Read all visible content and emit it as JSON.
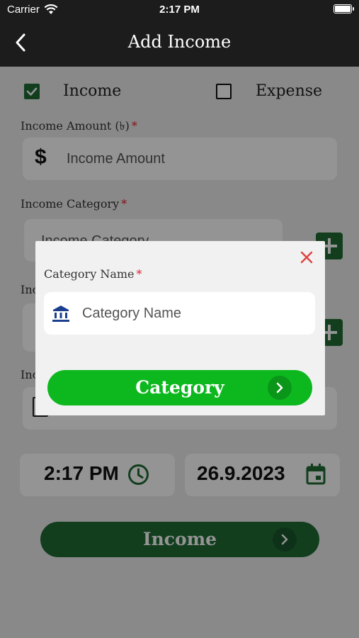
{
  "status_bar": {
    "carrier": "Carrier",
    "time": "2:17 PM"
  },
  "nav": {
    "title": "Add Income"
  },
  "type_toggle": {
    "income_label": "Income",
    "income_checked": true,
    "expense_label": "Expense",
    "expense_checked": false
  },
  "amount": {
    "label": "Income Amount (৳)",
    "required_mark": "*",
    "placeholder": "Income Amount"
  },
  "category": {
    "label": "Income Category",
    "required_mark": "*",
    "placeholder": "Income Category"
  },
  "hidden_labels": {
    "row3": "Inc",
    "row4": "Inc"
  },
  "datetime": {
    "time": "2:17 PM",
    "date": "26.9.2023"
  },
  "submit": {
    "label": "Income"
  },
  "dialog": {
    "label": "Category Name",
    "required_mark": "*",
    "placeholder": "Category Name",
    "button_label": "Category"
  },
  "colors": {
    "primary_dark": "#1f6b35",
    "primary_bright": "#0db81f",
    "required": "#d23",
    "close": "#e04040",
    "bank_icon": "#1b3f8f"
  }
}
